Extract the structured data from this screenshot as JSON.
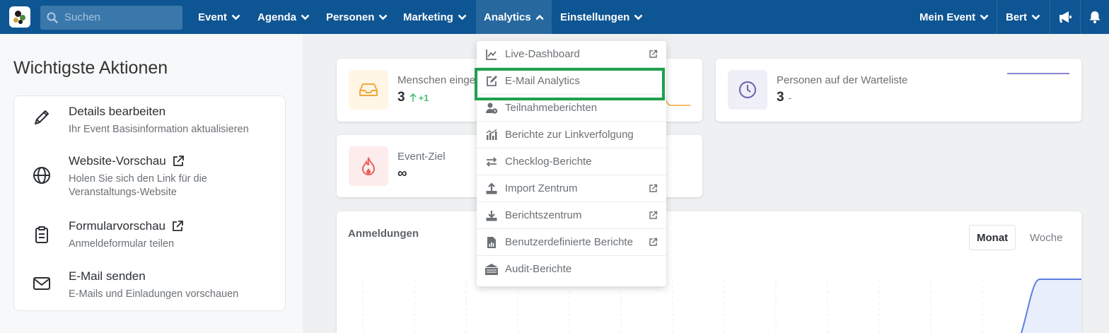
{
  "nav": {
    "search_placeholder": "Suchen",
    "items": [
      "Event",
      "Agenda",
      "Personen",
      "Marketing",
      "Analytics",
      "Einstellungen"
    ],
    "active_item": "Analytics",
    "right_items": [
      "Mein Event",
      "Bert"
    ]
  },
  "left_panel": {
    "title": "Wichtigste Aktionen",
    "actions": [
      {
        "title": "Details bearbeiten",
        "description": "Ihr Event Basisinformation aktualisieren",
        "icon": "pencil-icon",
        "external": false
      },
      {
        "title": "Website-Vorschau",
        "description": "Holen Sie sich den Link für die Veranstaltungs-Website",
        "icon": "globe-icon",
        "external": true
      },
      {
        "title": "Formularvorschau",
        "description": "Anmeldeformular teilen",
        "icon": "clipboard-icon",
        "external": true
      },
      {
        "title": "E-Mail senden",
        "description": "E-Mails und Einladungen vorschauen",
        "icon": "envelope-icon",
        "external": false
      }
    ]
  },
  "stats": {
    "people": {
      "label": "Menschen einge",
      "value": "3",
      "delta": "+1"
    },
    "waitlist": {
      "label": "Personen auf der Warteliste",
      "value": "3",
      "delta": "-"
    },
    "goal": {
      "label": "Event-Ziel",
      "value": "∞"
    }
  },
  "chart": {
    "title": "Anmeldungen",
    "toggle_active": "Monat",
    "toggle_inactive": "Woche"
  },
  "analytics_menu": {
    "items": [
      {
        "label": "Live-Dashboard",
        "icon": "line-chart-icon",
        "external": true
      },
      {
        "label": "E-Mail Analytics",
        "icon": "edit-icon",
        "external": false,
        "highlighted": true
      },
      {
        "label": "Teilnahmeberichten",
        "icon": "user-clock-icon",
        "external": false
      },
      {
        "label": "Berichte zur Linkverfolgung",
        "icon": "bar-chart-icon",
        "external": false
      },
      {
        "label": "Checklog-Berichte",
        "icon": "arrows-exchange-icon",
        "external": false
      },
      {
        "label": "Import Zentrum",
        "icon": "upload-icon",
        "external": true
      },
      {
        "label": "Berichtszentrum",
        "icon": "download-icon",
        "external": true
      },
      {
        "label": "Benutzerdefinierte Berichte",
        "icon": "report-file-icon",
        "external": true
      },
      {
        "label": "Audit-Berichte",
        "icon": "archive-icon",
        "external": false
      }
    ]
  },
  "colors": {
    "nav_bg": "#0e5593",
    "highlight": "#21a04d",
    "accent_green": "#4cc27a",
    "inbox_icon_bg": "#fff6e6",
    "flame_icon_bg": "#fdecec",
    "clock_icon_bg": "#efeff8"
  }
}
